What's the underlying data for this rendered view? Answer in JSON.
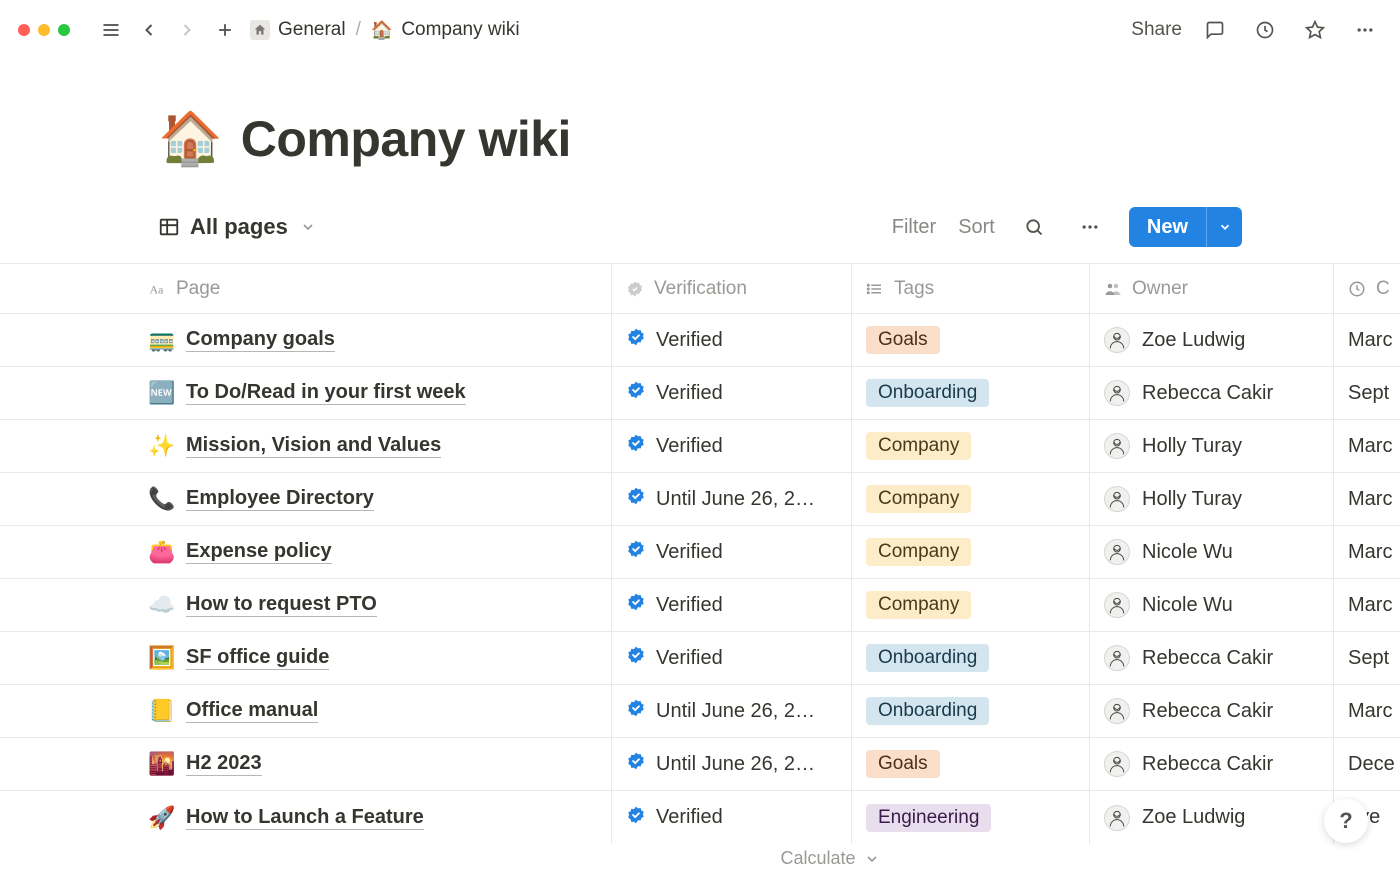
{
  "breadcrumb": {
    "parent": "General",
    "sep": "/",
    "current_icon": "🏠",
    "current": "Company wiki"
  },
  "topbar": {
    "share": "Share"
  },
  "page": {
    "icon": "🏠",
    "title": "Company wiki"
  },
  "view": {
    "name": "All pages",
    "filter": "Filter",
    "sort": "Sort",
    "new": "New",
    "calculate": "Calculate"
  },
  "columns": {
    "page": "Page",
    "verification": "Verification",
    "tags": "Tags",
    "owner": "Owner",
    "created": "C"
  },
  "rows": [
    {
      "emoji": "🚃",
      "title": "Company goals",
      "verif": "Verified",
      "tag": "Goals",
      "tagClass": "tag-goals",
      "owner": "Zoe Ludwig",
      "date": "Marc"
    },
    {
      "emoji": "🆕",
      "title": "To Do/Read in your first week",
      "verif": "Verified",
      "tag": "Onboarding",
      "tagClass": "tag-onboarding",
      "owner": "Rebecca Cakir",
      "date": "Sept"
    },
    {
      "emoji": "✨",
      "title": "Mission, Vision and Values",
      "verif": "Verified",
      "tag": "Company",
      "tagClass": "tag-company",
      "owner": "Holly Turay",
      "date": "Marc"
    },
    {
      "emoji": "📞",
      "title": "Employee Directory",
      "verif": "Until June 26, 2…",
      "tag": "Company",
      "tagClass": "tag-company",
      "owner": "Holly Turay",
      "date": "Marc"
    },
    {
      "emoji": "👛",
      "title": "Expense policy",
      "verif": "Verified",
      "tag": "Company",
      "tagClass": "tag-company",
      "owner": "Nicole Wu",
      "date": "Marc"
    },
    {
      "emoji": "☁️",
      "title": "How to request PTO",
      "verif": "Verified",
      "tag": "Company",
      "tagClass": "tag-company",
      "owner": "Nicole Wu",
      "date": "Marc"
    },
    {
      "emoji": "🖼️",
      "title": "SF office guide",
      "verif": "Verified",
      "tag": "Onboarding",
      "tagClass": "tag-onboarding",
      "owner": "Rebecca Cakir",
      "date": "Sept"
    },
    {
      "emoji": "📒",
      "title": "Office manual",
      "verif": "Until June 26, 2…",
      "tag": "Onboarding",
      "tagClass": "tag-onboarding",
      "owner": "Rebecca Cakir",
      "date": "Marc"
    },
    {
      "emoji": "🌇",
      "title": "H2 2023",
      "verif": "Until June 26, 2…",
      "tag": "Goals",
      "tagClass": "tag-goals",
      "owner": "Rebecca Cakir",
      "date": "Dece"
    },
    {
      "emoji": "🚀",
      "title": "How to Launch a Feature",
      "verif": "Verified",
      "tag": "Engineering",
      "tagClass": "tag-engineering",
      "owner": "Zoe Ludwig",
      "date": "ove"
    }
  ],
  "help": "?"
}
